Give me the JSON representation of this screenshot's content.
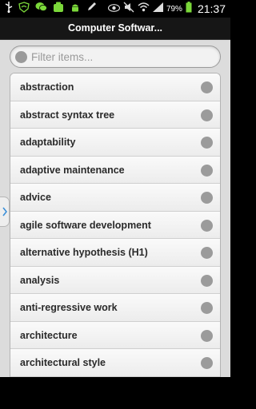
{
  "status_bar": {
    "left_icons": [
      "usb-icon",
      "wifi-shield-icon",
      "chat-icon",
      "android-icon",
      "android-icon",
      "pencil-icon"
    ],
    "right_icons": [
      "eye-icon",
      "mute-icon",
      "wifi-icon",
      "signal-icon",
      "battery-icon"
    ],
    "battery": "79%",
    "time": "21:37"
  },
  "title_bar": {
    "title": "Computer Softwar..."
  },
  "filter": {
    "placeholder": "Filter items..."
  },
  "list": {
    "items": [
      {
        "label": "abstraction"
      },
      {
        "label": "abstract syntax tree"
      },
      {
        "label": "adaptability"
      },
      {
        "label": "adaptive maintenance"
      },
      {
        "label": "advice"
      },
      {
        "label": "agile software development"
      },
      {
        "label": "alternative hypothesis (H1)"
      },
      {
        "label": "analysis"
      },
      {
        "label": "anti-regressive work"
      },
      {
        "label": "architecture"
      },
      {
        "label": "architectural style"
      },
      {
        "label": ""
      }
    ]
  },
  "colors": {
    "accent_green": "#7bd83a",
    "list_dot": "#9b9b9b",
    "title_bg": "#161616"
  }
}
